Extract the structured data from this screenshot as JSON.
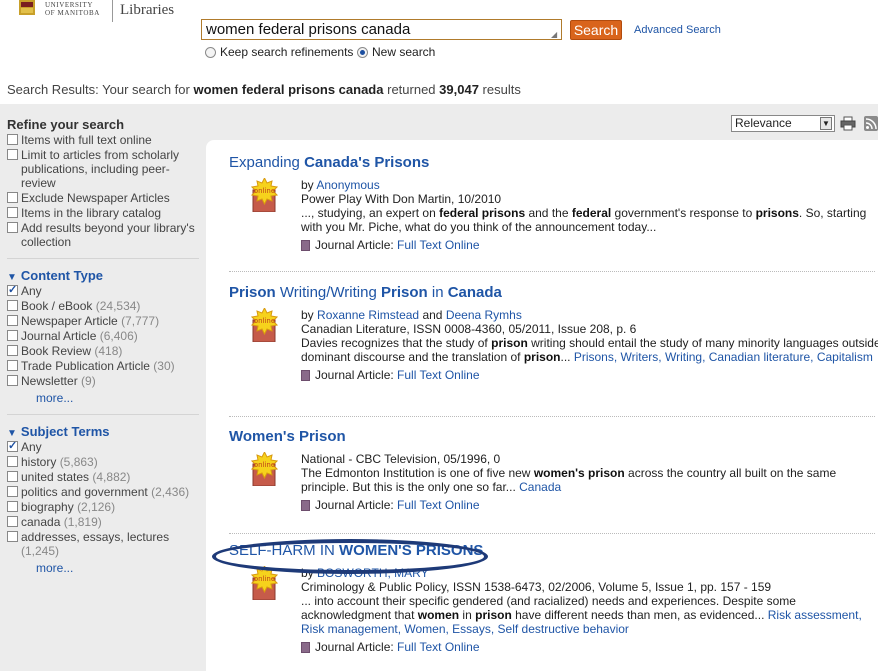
{
  "header": {
    "logo_university": "UNIVERSITY",
    "logo_of_manitoba": "OF MANITOBA",
    "logo_libraries": "Libraries",
    "search_value": "women federal prisons canada",
    "search_button": "Search",
    "advanced_search": "Advanced Search",
    "radio_keep": "Keep search refinements",
    "radio_new": "New search",
    "radio_selected": "new"
  },
  "summary": {
    "label": "Search Results:",
    "text_before": "Your search for",
    "query": "women federal prisons canada",
    "text_mid": "returned",
    "count": "39,047",
    "text_after": "results"
  },
  "sidebar": {
    "refine_heading": "Refine your search",
    "refine_options": [
      "Items with full text online",
      "Limit to articles from scholarly publications, including peer-review",
      "Exclude Newspaper Articles",
      "Items in the library catalog",
      "Add results beyond your library's collection"
    ],
    "content_type": {
      "heading": "Content Type",
      "any": "Any",
      "items": [
        {
          "label": "Book / eBook",
          "count": "(24,534)"
        },
        {
          "label": "Newspaper Article",
          "count": "(7,777)"
        },
        {
          "label": "Journal Article",
          "count": "(6,406)"
        },
        {
          "label": "Book Review",
          "count": "(418)"
        },
        {
          "label": "Trade Publication Article",
          "count": "(30)"
        },
        {
          "label": "Newsletter",
          "count": "(9)"
        }
      ],
      "more": "more..."
    },
    "subject_terms": {
      "heading": "Subject Terms",
      "any": "Any",
      "items": [
        {
          "label": "history",
          "count": "(5,863)"
        },
        {
          "label": "united states",
          "count": "(4,882)"
        },
        {
          "label": "politics and government",
          "count": "(2,436)"
        },
        {
          "label": "biography",
          "count": "(2,126)"
        },
        {
          "label": "canada",
          "count": "(1,819)"
        },
        {
          "label": "addresses, essays, lectures",
          "count": "(1,245)"
        }
      ],
      "more": "more..."
    }
  },
  "sort": {
    "selected": "Relevance"
  },
  "results": [
    {
      "title_pre": "Expanding ",
      "title_bold": "Canada's Prisons",
      "by": "by",
      "authors": "Anonymous",
      "source": "Power Play With Don Martin, 10/2010",
      "snippet_1": "..., studying, an expert on ",
      "snippet_2": "federal prisons",
      "snippet_3": " and the ",
      "snippet_4": "federal",
      "snippet_5": " government's response to ",
      "snippet_6": "prisons",
      "snippet_7": ". So, starting with you Mr. Piche, what do you think of the announcement today...",
      "type": "Journal Article:",
      "availability": "Full Text Online",
      "badge": "online"
    },
    {
      "title_1": "Prison",
      "title_2": " Writing/Writing ",
      "title_3": "Prison",
      "title_4": " in ",
      "title_5": "Canada",
      "by": "by",
      "author_1": "Roxanne Rimstead",
      "and": "and",
      "author_2": "Deena Rymhs",
      "source": "Canadian Literature, ISSN 0008-4360, 05/2011, Issue 208, p. 6",
      "snippet_1": "Davies recognizes that the study of ",
      "snippet_2": "prison",
      "snippet_3": " writing should entail the study of many minority languages outside dominant discourse and the translation of ",
      "snippet_4": "prison",
      "snippet_5": "...",
      "subjects": "Prisons, Writers, Writing, Canadian literature, Capitalism",
      "type": "Journal Article:",
      "availability": "Full Text Online",
      "badge": "online"
    },
    {
      "title": "Women's Prison",
      "source": "National - CBC Television, 05/1996, 0",
      "snippet_1": "The Edmonton Institution is one of five new ",
      "snippet_2": "women's prison",
      "snippet_3": " across the country all built on the same principle. But this is the only one so far...",
      "subjects": "Canada",
      "type": "Journal Article:",
      "availability": "Full Text Online",
      "badge": "online"
    },
    {
      "title_pre": "SELF-HARM IN ",
      "title_bold": "WOMEN'S PRISONS",
      "by": "by",
      "authors": "BOSWORTH, MARY",
      "source": "Criminology & Public Policy, ISSN 1538-6473, 02/2006, Volume 5, Issue 1, pp. 157 - 159",
      "snippet_1": "... into account their specific gendered (and racialized) needs and experiences. Despite some acknowledgment that ",
      "snippet_2": "women",
      "snippet_3": " in ",
      "snippet_4": "prison",
      "snippet_5": " have different needs than men, as evidenced...",
      "subjects": "Risk assessment, Risk management, Women, Essays, Self destructive behavior",
      "type": "Journal Article:",
      "availability": "Full Text Online",
      "badge": "online"
    }
  ],
  "colors": {
    "accent_orange": "#d9641c",
    "link_blue": "#1f55a6",
    "highlight_oval": "#1e3a78"
  }
}
